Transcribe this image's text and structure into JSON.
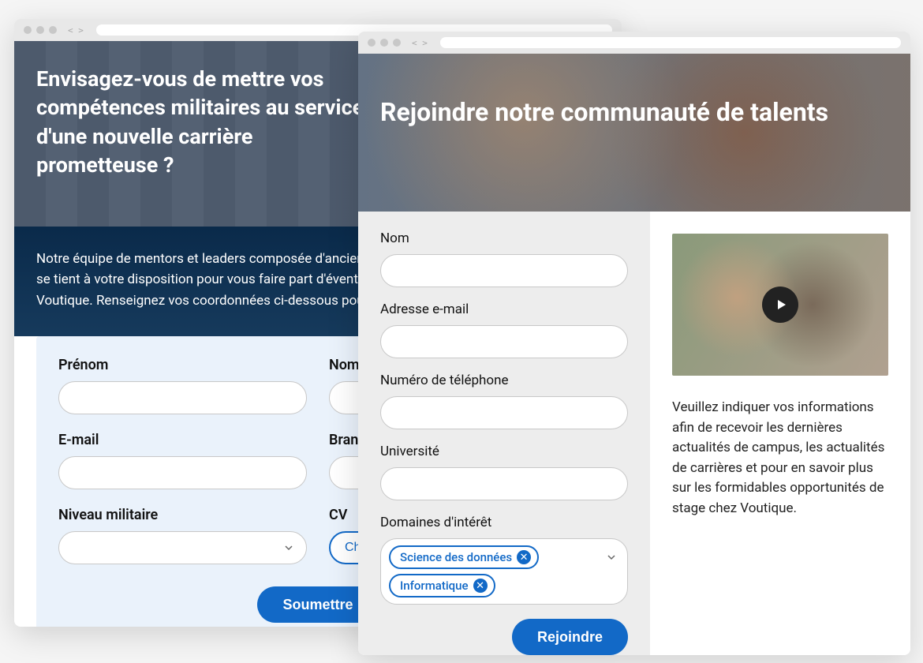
{
  "window_a": {
    "hero_title": "Envisagez-vous de mettre vos compétences militaires au service d'une nouvelle carrière prometteuse ?",
    "intro_text": "Notre équipe de mentors et leaders composée d'anciens militaires parle le même langage et se tient à votre disposition pour vous faire part d'éventuelles futures opportunités chez Voutique. Renseignez vos coordonnées ci-dessous pour nous permettre de vous contacter.",
    "fields": {
      "first_name": "Prénom",
      "last_name": "Nom",
      "email": "E-mail",
      "branch": "Branche",
      "military_rank": "Niveau militaire",
      "cv": "CV",
      "cv_button": "Choisir"
    },
    "submit": "Soumettre"
  },
  "window_b": {
    "hero_title": "Rejoindre notre communauté de talents",
    "fields": {
      "name": "Nom",
      "email": "Adresse e-mail",
      "phone": "Numéro de téléphone",
      "university": "Université",
      "interests": "Domaines d'intérêt"
    },
    "tags": [
      "Science des données",
      "Informatique"
    ],
    "submit": "Rejoindre",
    "sidebar_text": "Veuillez indiquer vos informations afin de recevoir les dernières actualités de campus, les actualités de carrières et pour en savoir plus sur les formidables opportunités de stage chez Voutique."
  }
}
